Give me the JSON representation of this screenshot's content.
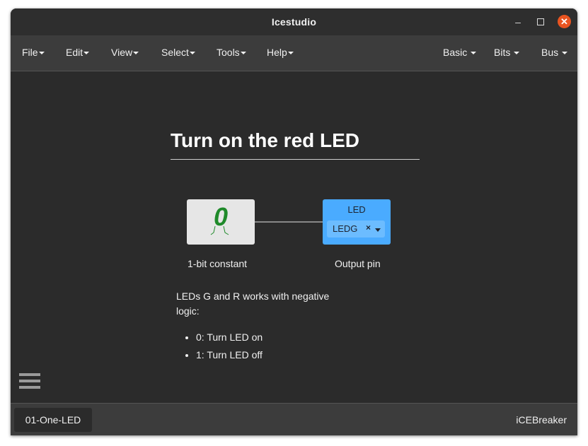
{
  "app": {
    "title": "Icestudio"
  },
  "menu": {
    "left": [
      {
        "label": "File"
      },
      {
        "label": "Edit"
      },
      {
        "label": "View"
      },
      {
        "label": "Select"
      },
      {
        "label": "Tools"
      },
      {
        "label": "Help"
      }
    ],
    "right": [
      {
        "label": "Basic"
      },
      {
        "label": "Bits"
      },
      {
        "label": "Bus"
      }
    ]
  },
  "design": {
    "heading": "Turn on the red LED",
    "constant_block": {
      "value": "0",
      "caption": "1-bit constant"
    },
    "output_block": {
      "name": "LED",
      "pin": "LEDG",
      "clear": "×",
      "caption": "Output pin"
    },
    "note": {
      "text": "LEDs G and R works with negative logic:",
      "items": [
        "0: Turn LED on",
        "1: Turn LED off"
      ]
    }
  },
  "status": {
    "tab": "01-One-LED",
    "board": "iCEBreaker"
  },
  "colors": {
    "accent": "#e95420",
    "led_block": "#4aabff",
    "constant_value": "#1f8a2a"
  },
  "icons": [
    "minimize-icon",
    "maximize-icon",
    "close-icon",
    "menu-icon"
  ]
}
